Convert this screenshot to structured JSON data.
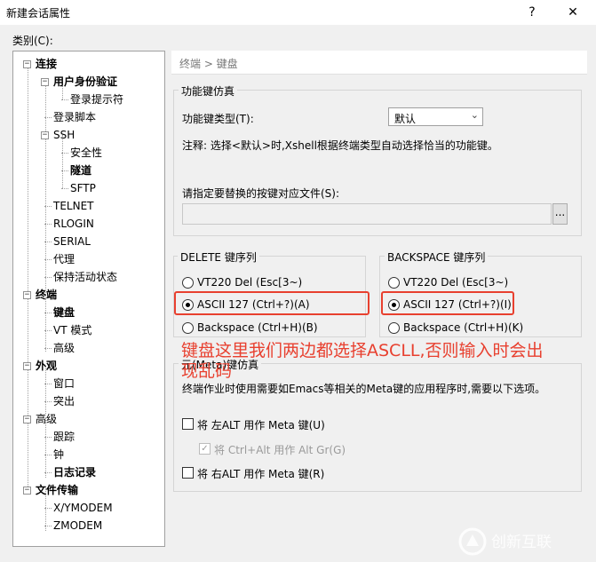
{
  "window": {
    "title": "新建会话属性",
    "help_label": "?",
    "close_label": "✕"
  },
  "category_label": "类别(C):",
  "tree": [
    {
      "label": "连接",
      "bold": true
    },
    {
      "label": "用户身份验证",
      "bold": true
    },
    {
      "label": "登录提示符",
      "bold": false
    },
    {
      "label": "登录脚本",
      "bold": false
    },
    {
      "label": "SSH",
      "bold": false
    },
    {
      "label": "安全性",
      "bold": false
    },
    {
      "label": "隧道",
      "bold": true
    },
    {
      "label": "SFTP",
      "bold": false
    },
    {
      "label": "TELNET",
      "bold": false
    },
    {
      "label": "RLOGIN",
      "bold": false
    },
    {
      "label": "SERIAL",
      "bold": false
    },
    {
      "label": "代理",
      "bold": false
    },
    {
      "label": "保持活动状态",
      "bold": false
    },
    {
      "label": "终端",
      "bold": true
    },
    {
      "label": "键盘",
      "bold": true
    },
    {
      "label": "VT 模式",
      "bold": false
    },
    {
      "label": "高级",
      "bold": false
    },
    {
      "label": "外观",
      "bold": true
    },
    {
      "label": "窗口",
      "bold": false
    },
    {
      "label": "突出",
      "bold": false
    },
    {
      "label": "高级",
      "bold": false
    },
    {
      "label": "跟踪",
      "bold": false
    },
    {
      "label": "钟",
      "bold": false
    },
    {
      "label": "日志记录",
      "bold": true
    },
    {
      "label": "文件传输",
      "bold": true
    },
    {
      "label": "X/YMODEM",
      "bold": false
    },
    {
      "label": "ZMODEM",
      "bold": false
    }
  ],
  "breadcrumb": "终端 > 键盘",
  "function_keys": {
    "group_title": "功能键仿真",
    "type_label": "功能键类型(T):",
    "type_value": "默认",
    "note": "注释: 选择<默认>时,Xshell根据终端类型自动选择恰当的功能键。",
    "file_label": "请指定要替换的按键对应文件(S):",
    "file_value": "",
    "browse_label": "..."
  },
  "delete_seq": {
    "title": "DELETE 键序列",
    "options": [
      "VT220 Del (Esc[3~)",
      "ASCII 127 (Ctrl+?)(A)",
      "Backspace (Ctrl+H)(B)"
    ],
    "selected": 1
  },
  "backspace_seq": {
    "title": "BACKSPACE 键序列",
    "options": [
      "VT220 Del (Esc[3~)",
      "ASCII 127 (Ctrl+?)(I)",
      "Backspace (Ctrl+H)(K)"
    ],
    "selected": 1
  },
  "meta": {
    "title": "元(Meta)键仿真",
    "desc": "终端作业时使用需要如Emacs等相关的Meta键的应用程序时,需要以下选项。",
    "opt_left": "将 左ALT 用作 Meta 键(U)",
    "opt_ctrl_alt": "将 Ctrl+Alt 用作 Alt Gr(G)",
    "opt_right": "将 右ALT 用作 Meta 键(R)"
  },
  "annotation": {
    "line1": "键盘这里我们两边都选择ASCLL,否则输入时会出",
    "line2": "现乱码",
    "color": "#e8402f"
  },
  "watermark": {
    "text": "创新互联"
  }
}
